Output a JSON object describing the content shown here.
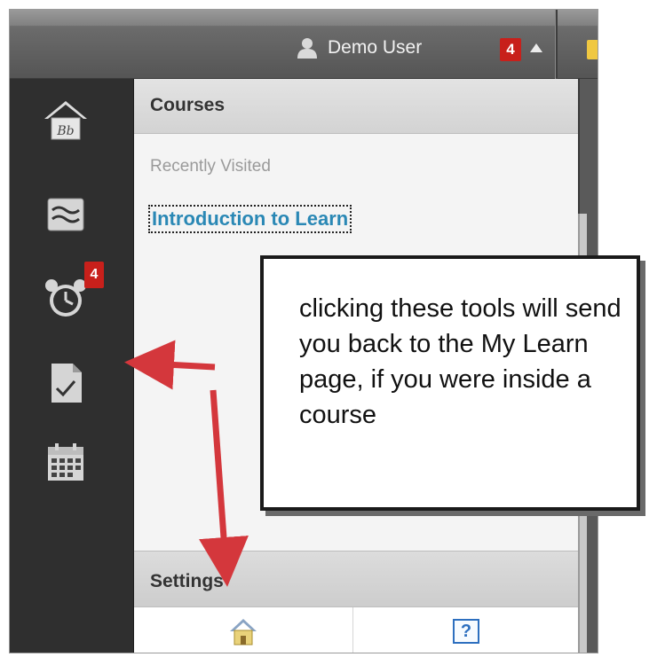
{
  "topbar": {
    "user_name": "Demo User",
    "notification_count": "4"
  },
  "sidebar": {
    "icons": [
      "bb-home-icon",
      "updates-icon",
      "alarm-clock-icon",
      "graded-doc-icon",
      "calendar-icon"
    ],
    "alarm_badge": "4"
  },
  "panel": {
    "courses_header": "Courses",
    "recently_visited_label": "Recently Visited",
    "course_link": "Introduction to Learn",
    "settings_header": "Settings",
    "help_label": "?"
  },
  "callout": {
    "text": "clicking these tools will send you back to the My Learn page, if you were inside a course"
  },
  "colors": {
    "badge_red": "#c8201b",
    "link_blue": "#2a88b5",
    "arrow_red": "#d4373c"
  }
}
